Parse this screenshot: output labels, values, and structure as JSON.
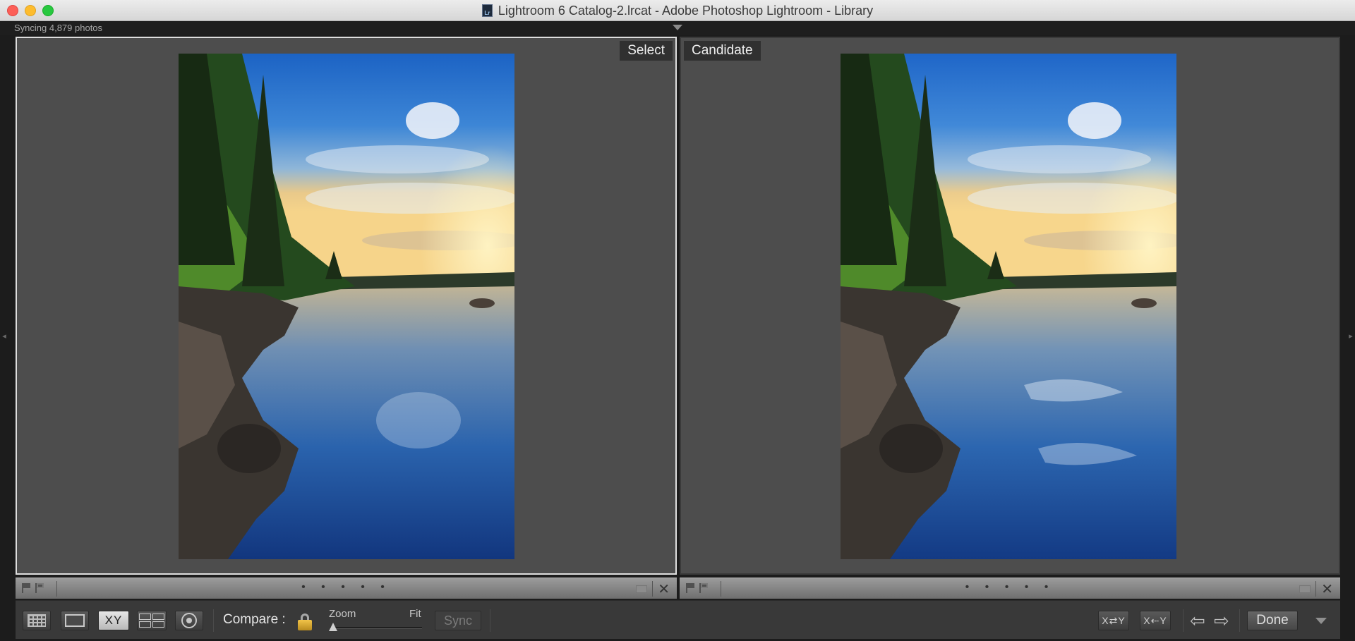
{
  "window": {
    "title": "Lightroom 6 Catalog-2.lrcat - Adobe Photoshop Lightroom - Library",
    "doc_icon_label": "Lr"
  },
  "status": {
    "sync_text": "Syncing 4,879 photos"
  },
  "compare": {
    "select_label": "Select",
    "candidate_label": "Candidate"
  },
  "strip": {
    "dots": "• • • • •",
    "close_symbol": "✕"
  },
  "toolbar": {
    "compare_label": "Compare :",
    "zoom_label": "Zoom",
    "fit_label": "Fit",
    "zoom_level": 0,
    "sync_label": "Sync",
    "swap_label": "X⇄Y",
    "make_select_label": "X⇠Y",
    "prev_symbol": "⇦",
    "next_symbol": "⇨",
    "done_label": "Done",
    "xy_label": "XY"
  },
  "icons": {
    "grid": "grid-view-icon",
    "loupe": "loupe-view-icon",
    "compare": "compare-view-icon",
    "survey": "survey-view-icon",
    "people": "people-view-icon",
    "lock": "lock-icon"
  },
  "colors": {
    "panel_bg": "#4d4d4d",
    "selected_border": "#dedede",
    "lock_gold": "#e3b53a"
  }
}
